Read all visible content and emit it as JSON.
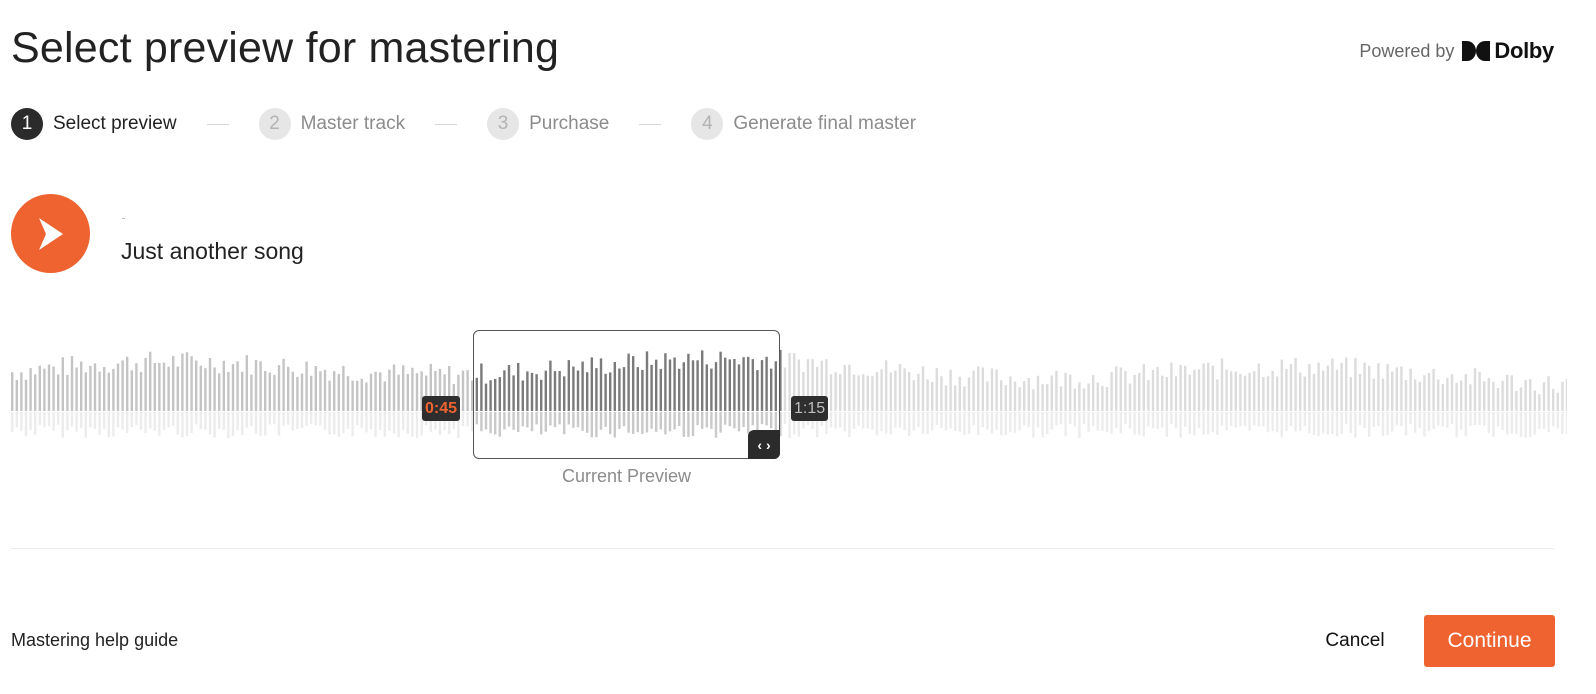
{
  "page": {
    "title": "Select preview for mastering"
  },
  "branding": {
    "powered_by": "Powered by",
    "brand_name": "Dolby"
  },
  "stepper": {
    "steps": [
      {
        "number": "1",
        "label": "Select preview",
        "state": "active"
      },
      {
        "number": "2",
        "label": "Master track",
        "state": "inactive"
      },
      {
        "number": "3",
        "label": "Purchase",
        "state": "inactive"
      },
      {
        "number": "4",
        "label": "Generate final master",
        "state": "inactive"
      }
    ]
  },
  "track": {
    "title": "Just another song",
    "play_icon": "play-icon"
  },
  "preview": {
    "start_time": "0:45",
    "end_time": "1:15",
    "caption": "Current Preview",
    "handle_icon": "drag-arrows-icon",
    "handle_glyph": "‹ ›"
  },
  "footer": {
    "help_link": "Mastering help guide",
    "cancel_label": "Cancel",
    "continue_label": "Continue"
  },
  "colors": {
    "accent": "#ee6330",
    "active_step": "#2b2b2b",
    "waveform_inactive": "#cfcfcf",
    "waveform_selected": "#7a7a7a"
  }
}
